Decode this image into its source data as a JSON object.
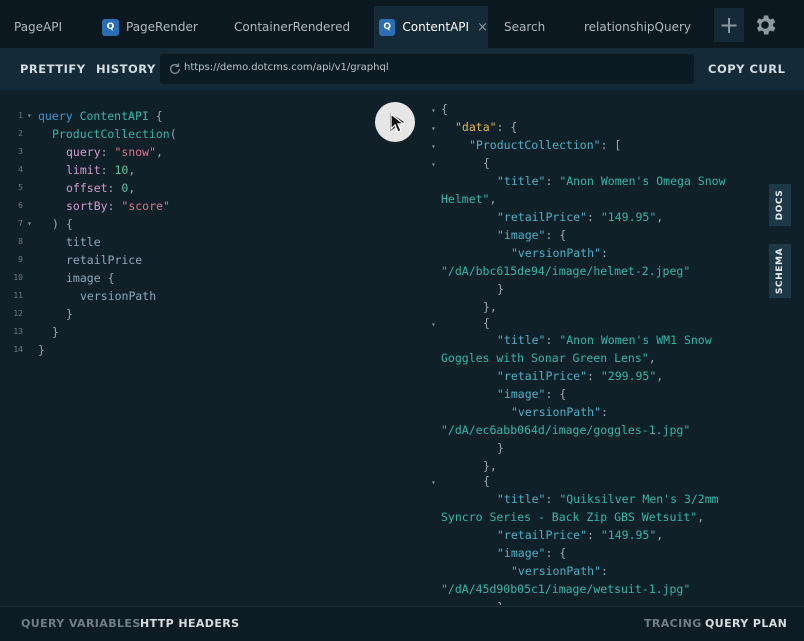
{
  "tabs": [
    {
      "label": "PageAPI",
      "badge": ""
    },
    {
      "label": "PageRender",
      "badge": "Q"
    },
    {
      "label": "ContainerRendered",
      "badge": ""
    },
    {
      "label": "ContentAPI",
      "badge": "Q",
      "close": "×"
    },
    {
      "label": "Search",
      "badge": ""
    },
    {
      "label": "relationshipQuery",
      "badge": ""
    }
  ],
  "add_tab_label": "+",
  "toolbar": {
    "prettify": "PRETTIFY",
    "history": "HISTORY",
    "url": "https://demo.dotcms.com/api/v1/graphql",
    "copy_curl": "COPY CURL"
  },
  "editor": {
    "line_numbers": [
      "1",
      "2",
      "3",
      "4",
      "5",
      "6",
      "7",
      "8",
      "9",
      "10",
      "11",
      "12",
      "13",
      "14"
    ],
    "fold_marker": "▾",
    "query_keyword": "query",
    "query_name": "ContentAPI",
    "collection": "ProductCollection",
    "args": [
      {
        "name": "query",
        "value": "\"snow\""
      },
      {
        "name": "limit",
        "value": "10"
      },
      {
        "name": "offset",
        "value": "0"
      },
      {
        "name": "sortBy",
        "value": "\"score\""
      }
    ],
    "fields": [
      "title",
      "retailPrice",
      "image",
      "versionPath"
    ]
  },
  "result": {
    "data_key": "\"data\"",
    "collection_key": "\"ProductCollection\"",
    "items": [
      {
        "title_a": "\"Anon Women's Omega Snow",
        "title_b": "Helmet\"",
        "price": "\"149.95\"",
        "path": "\"/dA/bbc615de94/image/helmet-2.jpeg\""
      },
      {
        "title_a": "\"Anon Women's WM1 Snow",
        "title_b": "Goggles with Sonar Green Lens\"",
        "price": "\"299.95\"",
        "path": "\"/dA/ec6abb064d/image/goggles-1.jpg\""
      },
      {
        "title_a": "\"Quiksilver Men's 3/2mm",
        "title_b": "Syncro Series - Back Zip GBS Wetsuit\"",
        "price": "\"149.95\"",
        "path": "\"/dA/45d90b05c1/image/wetsuit-1.jpg\""
      }
    ],
    "keys": {
      "title": "\"title\"",
      "retailPrice": "\"retailPrice\"",
      "image": "\"image\"",
      "versionPath": "\"versionPath\""
    }
  },
  "side": {
    "docs": "DOCS",
    "schema": "SCHEMA"
  },
  "footer": {
    "query_variables": "QUERY VARIABLES",
    "http_headers": "HTTP HEADERS",
    "tracing": "TRACING",
    "query_plan": "QUERY PLAN"
  },
  "icons": {
    "gear": "gear-icon",
    "reload": "reload-icon",
    "play": "play-icon",
    "cursor": "cursor-icon"
  }
}
